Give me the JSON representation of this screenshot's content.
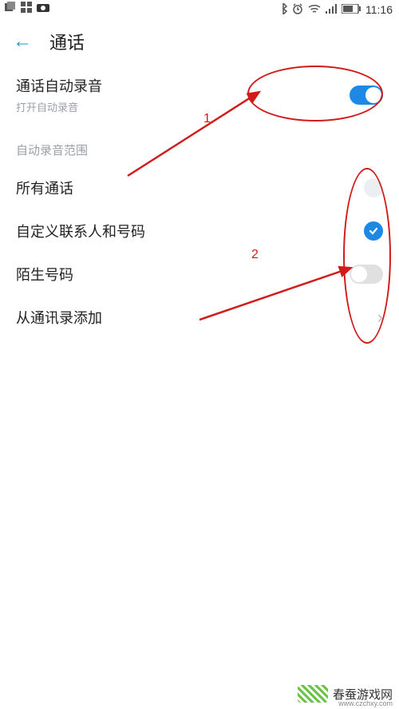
{
  "status": {
    "time": "11:16"
  },
  "header": {
    "title": "通话"
  },
  "auto_record": {
    "title": "通话自动录音",
    "subtitle": "打开自动录音",
    "enabled": true
  },
  "scope_section_label": "自动录音范围",
  "scope": {
    "all_calls": {
      "label": "所有通话",
      "selected": false
    },
    "custom": {
      "label": "自定义联系人和号码",
      "selected": true
    },
    "stranger": {
      "label": "陌生号码",
      "enabled": false
    }
  },
  "add_from_contacts": {
    "label": "从通讯录添加"
  },
  "annotations": {
    "num1": "1",
    "num2": "2"
  },
  "watermark": {
    "text": "春蚕游戏网",
    "url": "www.czchxy.com"
  }
}
